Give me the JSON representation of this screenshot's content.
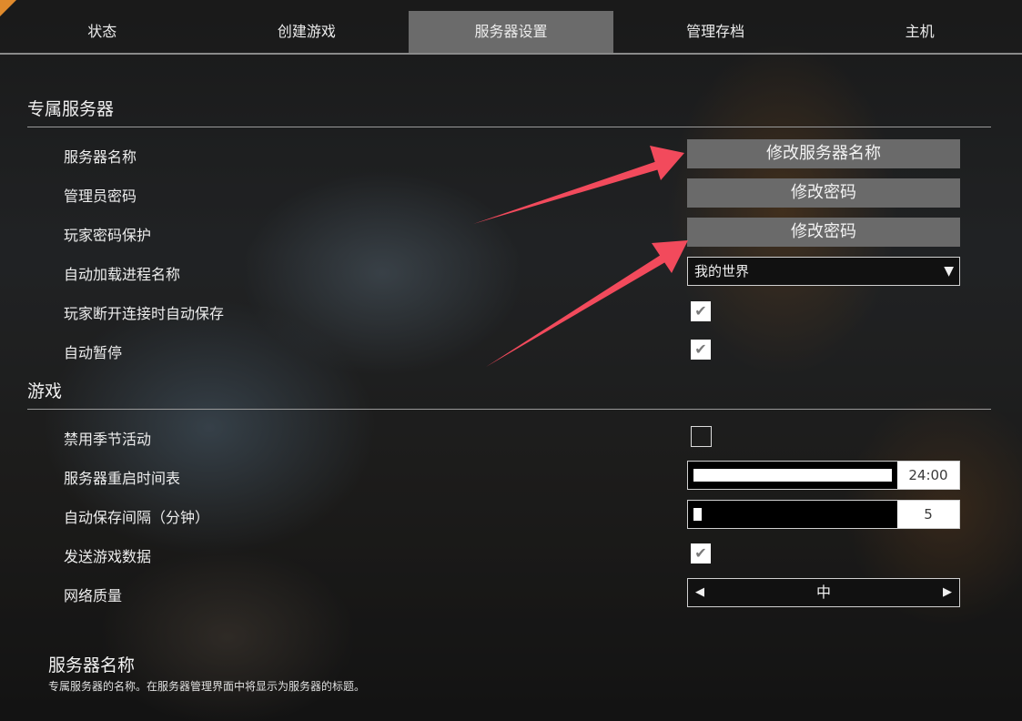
{
  "tabs": [
    {
      "label": "状态"
    },
    {
      "label": "创建游戏"
    },
    {
      "label": "服务器设置",
      "active": true
    },
    {
      "label": "管理存档"
    },
    {
      "label": "主机"
    }
  ],
  "sections": {
    "dedicated": {
      "title": "专属服务器"
    },
    "game": {
      "title": "游戏"
    }
  },
  "rows": {
    "server_name": {
      "label": "服务器名称",
      "button": "修改服务器名称"
    },
    "admin_password": {
      "label": "管理员密码",
      "button": "修改密码"
    },
    "player_password": {
      "label": "玩家密码保护",
      "button": "修改密码"
    },
    "autoload": {
      "label": "自动加载进程名称",
      "value": "我的世界"
    },
    "autosave_disconnect": {
      "label": "玩家断开连接时自动保存",
      "checked": true
    },
    "autopause": {
      "label": "自动暂停",
      "checked": true
    },
    "disable_seasonal": {
      "label": "禁用季节活动",
      "checked": false
    },
    "restart_schedule": {
      "label": "服务器重启时间表",
      "value": "24:00",
      "fill_fraction": 1.0
    },
    "autosave_interval": {
      "label": "自动保存间隔（分钟）",
      "value": "5",
      "fill_fraction": 0.04
    },
    "send_data": {
      "label": "发送游戏数据",
      "checked": true
    },
    "network_quality": {
      "label": "网络质量",
      "value": "中"
    }
  },
  "description": {
    "title": "服务器名称",
    "text": "专属服务器的名称。在服务器管理界面中将显示为服务器的标题。"
  },
  "icons": {
    "check": "✔",
    "dropdown": "▼",
    "left": "◀",
    "right": "▶"
  },
  "colors": {
    "annotation_arrow": "#f24a5c",
    "active_tab": "#6b6b6b",
    "button": "#6a6a6a"
  }
}
